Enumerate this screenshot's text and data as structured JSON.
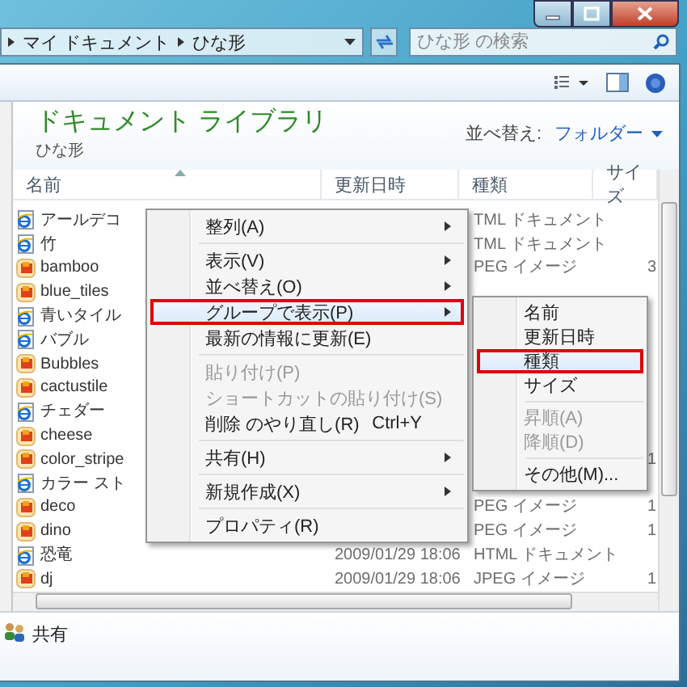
{
  "address": {
    "crumbs": [
      "マイ ドキュメント",
      "ひな形"
    ]
  },
  "search": {
    "placeholder": "ひな形 の検索"
  },
  "library": {
    "title": "ドキュメント ライブラリ",
    "subtitle": "ひな形",
    "arrange_label": "並べ替え:",
    "arrange_value": "フォルダー"
  },
  "columns": [
    "名前",
    "更新日時",
    "種類",
    "サイズ"
  ],
  "rows": [
    {
      "kind": "html",
      "name": "アールデコ",
      "type": "TML ドキュメント"
    },
    {
      "kind": "html",
      "name": "竹",
      "type": "TML ドキュメント"
    },
    {
      "kind": "image",
      "name": "bamboo",
      "type": "PEG イメージ",
      "size": "3"
    },
    {
      "kind": "image",
      "name": "blue_tiles"
    },
    {
      "kind": "html",
      "name": "青いタイル"
    },
    {
      "kind": "html",
      "name": "バブル"
    },
    {
      "kind": "image",
      "name": "Bubbles"
    },
    {
      "kind": "image",
      "name": "cactustile"
    },
    {
      "kind": "html",
      "name": "チェダー"
    },
    {
      "kind": "image",
      "name": "cheese"
    },
    {
      "kind": "image",
      "name": "color_stripe",
      "size": "1"
    },
    {
      "kind": "html",
      "name": "カラー スト"
    },
    {
      "kind": "image",
      "name": "deco",
      "type": "PEG イメージ",
      "size": "1"
    },
    {
      "kind": "image",
      "name": "dino",
      "type": "PEG イメージ",
      "size": "1"
    },
    {
      "kind": "html",
      "name": "恐竜",
      "modified": "2009/01/29 18:06",
      "type": "HTML ドキュメント"
    },
    {
      "kind": "image",
      "name": "dj",
      "modified": "2009/01/29 18:06",
      "type": "JPEG イメージ",
      "size": "1"
    }
  ],
  "context_menu": [
    {
      "kind": "item",
      "label": "整列(A)",
      "submenu": true,
      "disabled": false,
      "highlighted": false
    },
    {
      "kind": "separator"
    },
    {
      "kind": "item",
      "label": "表示(V)",
      "submenu": true,
      "disabled": false,
      "highlighted": false
    },
    {
      "kind": "item",
      "label": "並べ替え(O)",
      "submenu": true,
      "disabled": false,
      "highlighted": false
    },
    {
      "kind": "item",
      "label": "グループで表示(P)",
      "submenu": true,
      "disabled": false,
      "highlighted": true
    },
    {
      "kind": "item",
      "label": "最新の情報に更新(E)",
      "submenu": false,
      "disabled": false,
      "highlighted": false
    },
    {
      "kind": "separator"
    },
    {
      "kind": "item",
      "label": "貼り付け(P)",
      "submenu": false,
      "disabled": true,
      "highlighted": false
    },
    {
      "kind": "item",
      "label": "ショートカットの貼り付け(S)",
      "submenu": false,
      "disabled": true,
      "highlighted": false
    },
    {
      "kind": "item",
      "label": "削除 のやり直し(R)",
      "shortcut": "Ctrl+Y",
      "submenu": false,
      "disabled": false,
      "highlighted": false
    },
    {
      "kind": "separator"
    },
    {
      "kind": "item",
      "label": "共有(H)",
      "submenu": true,
      "disabled": false,
      "highlighted": false
    },
    {
      "kind": "separator"
    },
    {
      "kind": "item",
      "label": "新規作成(X)",
      "submenu": true,
      "disabled": false,
      "highlighted": false
    },
    {
      "kind": "separator"
    },
    {
      "kind": "item",
      "label": "プロパティ(R)",
      "submenu": false,
      "disabled": false,
      "highlighted": false
    }
  ],
  "submenu": [
    {
      "kind": "item",
      "label": "名前",
      "disabled": false,
      "highlighted": false
    },
    {
      "kind": "item",
      "label": "更新日時",
      "disabled": false,
      "highlighted": false
    },
    {
      "kind": "item",
      "label": "種類",
      "disabled": false,
      "highlighted": true
    },
    {
      "kind": "item",
      "label": "サイズ",
      "disabled": false,
      "highlighted": false
    },
    {
      "kind": "separator"
    },
    {
      "kind": "item",
      "label": "昇順(A)",
      "disabled": true,
      "highlighted": false
    },
    {
      "kind": "item",
      "label": "降順(D)",
      "disabled": true,
      "highlighted": false
    },
    {
      "kind": "separator"
    },
    {
      "kind": "item",
      "label": "その他(M)...",
      "disabled": false,
      "highlighted": false
    }
  ],
  "status_bar": {
    "label": "共有"
  }
}
